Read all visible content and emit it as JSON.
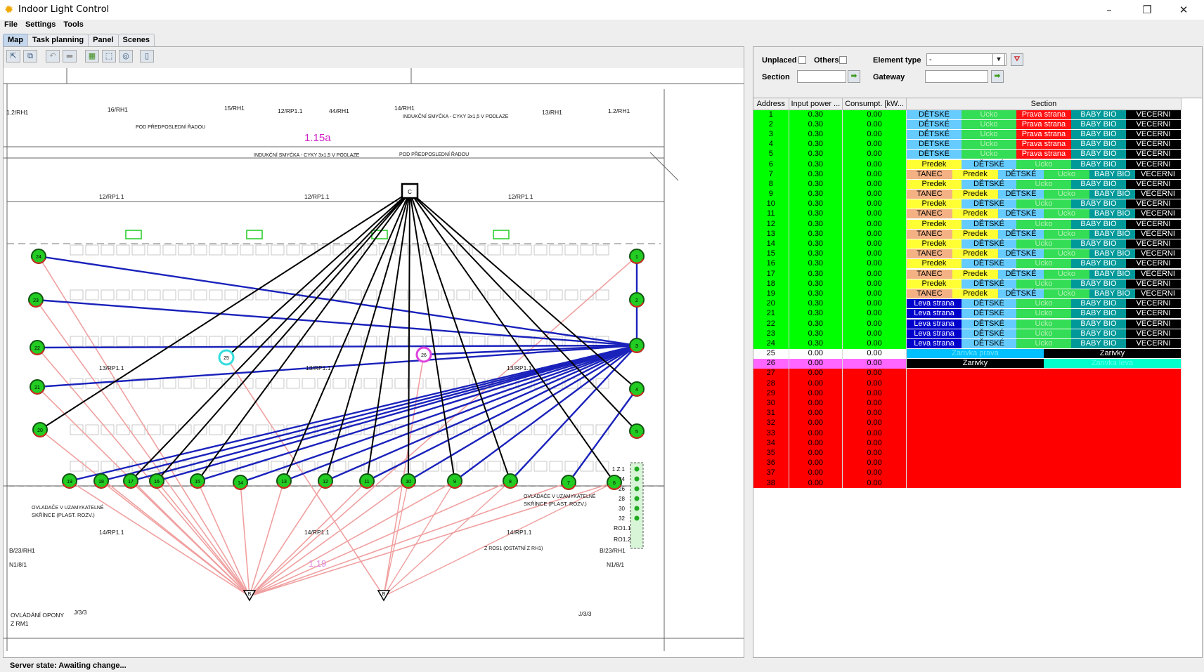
{
  "window": {
    "title": "Indoor Light Control",
    "minimize": "–",
    "maximize": "❐",
    "close": "✕"
  },
  "menu": [
    "File",
    "Settings",
    "Tools"
  ],
  "tabs": [
    "Map",
    "Task planning",
    "Panel",
    "Scenes"
  ],
  "toolbar_icons": [
    "pointer-tool",
    "multi-select-tool",
    "undo",
    "delete",
    "layer-tool",
    "fit-tool",
    "zoom-tool",
    "window-tool"
  ],
  "map": {
    "room_label": "1.15a",
    "room_label_2": "1.19",
    "controller_label": "C",
    "gateway_label": "B",
    "colors": {
      "element_ring_green": "#00cc00",
      "link_black": "#000000",
      "link_blue": "#1a22bb",
      "link_pink": "#f0a0a0",
      "room_label": "#d020c8"
    },
    "texts": [
      "1.2/RH1",
      "16/RH1",
      "15/RH1",
      "12/RP1.1",
      "44/RH1",
      "14/RH1",
      "13/RH1",
      "1.2/RH1",
      "POD PŘEDPOSLEDNÍ ŘADOU",
      "INDUKČNÍ SMYČKA - CYKY 3x1,5 V PODLAZE",
      "INDUKČNÍ SMYČKA - CYKY 3x1,5 V PODLAZE",
      "POD PŘEDPOSLEDNÍ ŘADOU",
      "12/RP1.1",
      "12/RP1.1",
      "12/RP1.1",
      "13/RP1.1",
      "13/RP1.1",
      "13/RP1.1",
      "OVLADAČE V UZAMYKATELNÉ SKŘÍNCE (PLAST. ROZV.)",
      "OVLADAČE V UZAMYKATELNÉ SKŘÍNCE (PLAST. ROZV.)",
      "14/RP1.1",
      "14/RP1.1",
      "14/RP1.1",
      "B/23/RH1",
      "N1/8/1",
      "B/23/RH1",
      "N1/8/1",
      "Z ROS1 (OSTATNÍ Z RH1)",
      "RO1.1",
      "RO1.2",
      "OVLÁDÁNÍ OPONY",
      "Z RM1",
      "J/3/3",
      "J/3/3"
    ],
    "panel_labels": [
      "1.Z.1",
      "24",
      "26",
      "28",
      "30",
      "32"
    ],
    "elements": [
      "1",
      "2",
      "3",
      "4",
      "5",
      "6",
      "7",
      "8",
      "9",
      "10",
      "11",
      "12",
      "13",
      "14",
      "15",
      "16",
      "17",
      "18",
      "19",
      "20",
      "21",
      "22",
      "23",
      "24",
      "25",
      "26"
    ]
  },
  "filter": {
    "unplaced_label": "Unplaced",
    "others_label": "Others",
    "element_type_label": "Element type",
    "element_type_value": "-",
    "section_label": "Section",
    "gateway_label": "Gateway",
    "section_value": "",
    "gateway_value": ""
  },
  "grid": {
    "headers": [
      "Address",
      "Input power ...",
      "Consumpt. [kW...",
      "Section"
    ],
    "colors": {
      "green": "#00ff00",
      "white": "#ffffff",
      "magenta": "#ff66ff",
      "red": "#ff0000"
    },
    "section_colors": {
      "DĚTSKÉ": [
        "#66ccff",
        "#000"
      ],
      "Ucko": [
        "#33dd55",
        "#b7f0b7"
      ],
      "Prava strana": [
        "#ff1111",
        "#fff"
      ],
      "BABY BIO": [
        "#009999",
        "#fff"
      ],
      "VECERNI": [
        "#000000",
        "#fff"
      ],
      "Predek": [
        "#ffff33",
        "#000"
      ],
      "TANEC": [
        "#f4b183",
        "#000"
      ],
      "Leva strana": [
        "#0000cc",
        "#fff"
      ],
      "Zarivka prava": [
        "#00c0ff",
        "#70e6ff"
      ],
      "Zarivky": [
        "#000000",
        "#fff"
      ],
      "Zarivka leva": [
        "#00ffcc",
        "#66ffee"
      ]
    },
    "rows": [
      {
        "addr": "1",
        "inp": "0.30",
        "cons": "0.00",
        "bg": "green",
        "sections": [
          "DĚTSKÉ",
          "Ucko",
          "Prava strana",
          "BABY BIO",
          "VECERNI"
        ]
      },
      {
        "addr": "2",
        "inp": "0.30",
        "cons": "0.00",
        "bg": "green",
        "sections": [
          "DĚTSKÉ",
          "Ucko",
          "Prava strana",
          "BABY BIO",
          "VECERNI"
        ]
      },
      {
        "addr": "3",
        "inp": "0.30",
        "cons": "0.00",
        "bg": "green",
        "sections": [
          "DĚTSKÉ",
          "Ucko",
          "Prava strana",
          "BABY BIO",
          "VECERNI"
        ]
      },
      {
        "addr": "4",
        "inp": "0.30",
        "cons": "0.00",
        "bg": "green",
        "sections": [
          "DĚTSKÉ",
          "Ucko",
          "Prava strana",
          "BABY BIO",
          "VECERNI"
        ]
      },
      {
        "addr": "5",
        "inp": "0.30",
        "cons": "0.00",
        "bg": "green",
        "sections": [
          "DĚTSKÉ",
          "Ucko",
          "Prava strana",
          "BABY BIO",
          "VECERNI"
        ]
      },
      {
        "addr": "6",
        "inp": "0.30",
        "cons": "0.00",
        "bg": "green",
        "sections": [
          "Predek",
          "DĚTSKÉ",
          "Ucko",
          "BABY BIO",
          "VECERNI"
        ]
      },
      {
        "addr": "7",
        "inp": "0.30",
        "cons": "0.00",
        "bg": "green",
        "sections": [
          "TANEC",
          "Predek",
          "DĚTSKÉ",
          "Ucko",
          "BABY BIO",
          "VECERNI"
        ]
      },
      {
        "addr": "8",
        "inp": "0.30",
        "cons": "0.00",
        "bg": "green",
        "sections": [
          "Predek",
          "DĚTSKÉ",
          "Ucko",
          "BABY BIO",
          "VECERNI"
        ]
      },
      {
        "addr": "9",
        "inp": "0.30",
        "cons": "0.00",
        "bg": "green",
        "sections": [
          "TANEC",
          "Predek",
          "DĚTSKÉ",
          "Ucko",
          "BABY BIO",
          "VECERNI"
        ]
      },
      {
        "addr": "10",
        "inp": "0.30",
        "cons": "0.00",
        "bg": "green",
        "sections": [
          "Predek",
          "DĚTSKÉ",
          "Ucko",
          "BABY BIO",
          "VECERNI"
        ]
      },
      {
        "addr": "11",
        "inp": "0.30",
        "cons": "0.00",
        "bg": "green",
        "sections": [
          "TANEC",
          "Predek",
          "DĚTSKÉ",
          "Ucko",
          "BABY BIO",
          "VECERNI"
        ]
      },
      {
        "addr": "12",
        "inp": "0.30",
        "cons": "0.00",
        "bg": "green",
        "sections": [
          "Predek",
          "DĚTSKÉ",
          "Ucko",
          "BABY BIO",
          "VECERNI"
        ]
      },
      {
        "addr": "13",
        "inp": "0.30",
        "cons": "0.00",
        "bg": "green",
        "sections": [
          "TANEC",
          "Predek",
          "DĚTSKÉ",
          "Ucko",
          "BABY BIO",
          "VECERNI"
        ]
      },
      {
        "addr": "14",
        "inp": "0.30",
        "cons": "0.00",
        "bg": "green",
        "sections": [
          "Predek",
          "DĚTSKÉ",
          "Ucko",
          "BABY BIO",
          "VECERNI"
        ]
      },
      {
        "addr": "15",
        "inp": "0.30",
        "cons": "0.00",
        "bg": "green",
        "sections": [
          "TANEC",
          "Predek",
          "DĚTSKÉ",
          "Ucko",
          "BABY BIO",
          "VECERNI"
        ]
      },
      {
        "addr": "16",
        "inp": "0.30",
        "cons": "0.00",
        "bg": "green",
        "sections": [
          "Predek",
          "DĚTSKÉ",
          "Ucko",
          "BABY BIO",
          "VECERNI"
        ]
      },
      {
        "addr": "17",
        "inp": "0.30",
        "cons": "0.00",
        "bg": "green",
        "sections": [
          "TANEC",
          "Predek",
          "DĚTSKÉ",
          "Ucko",
          "BABY BIO",
          "VECERNI"
        ]
      },
      {
        "addr": "18",
        "inp": "0.30",
        "cons": "0.00",
        "bg": "green",
        "sections": [
          "Predek",
          "DĚTSKÉ",
          "Ucko",
          "BABY BIO",
          "VECERNI"
        ]
      },
      {
        "addr": "19",
        "inp": "0.30",
        "cons": "0.00",
        "bg": "green",
        "sections": [
          "TANEC",
          "Predek",
          "DĚTSKÉ",
          "Ucko",
          "BABY BIO",
          "VECERNI"
        ]
      },
      {
        "addr": "20",
        "inp": "0.30",
        "cons": "0.00",
        "bg": "green",
        "sections": [
          "Leva strana",
          "DĚTSKÉ",
          "Ucko",
          "BABY BIO",
          "VECERNI"
        ]
      },
      {
        "addr": "21",
        "inp": "0.30",
        "cons": "0.00",
        "bg": "green",
        "sections": [
          "Leva strana",
          "DĚTSKÉ",
          "Ucko",
          "BABY BIO",
          "VECERNI"
        ]
      },
      {
        "addr": "22",
        "inp": "0.30",
        "cons": "0.00",
        "bg": "green",
        "sections": [
          "Leva strana",
          "DĚTSKÉ",
          "Ucko",
          "BABY BIO",
          "VECERNI"
        ]
      },
      {
        "addr": "23",
        "inp": "0.30",
        "cons": "0.00",
        "bg": "green",
        "sections": [
          "Leva strana",
          "DĚTSKÉ",
          "Ucko",
          "BABY BIO",
          "VECERNI"
        ]
      },
      {
        "addr": "24",
        "inp": "0.30",
        "cons": "0.00",
        "bg": "green",
        "sections": [
          "Leva strana",
          "DĚTSKÉ",
          "Ucko",
          "BABY BIO",
          "VECERNI"
        ]
      },
      {
        "addr": "25",
        "inp": "0.00",
        "cons": "0.00",
        "bg": "white",
        "sections": [
          "Zarivka prava",
          "Zarivky"
        ]
      },
      {
        "addr": "26",
        "inp": "0.00",
        "cons": "0.00",
        "bg": "magenta",
        "sections": [
          "Zarivky",
          "Zarivka leva"
        ]
      },
      {
        "addr": "27",
        "inp": "0.00",
        "cons": "0.00",
        "bg": "red",
        "sections": []
      },
      {
        "addr": "28",
        "inp": "0.00",
        "cons": "0.00",
        "bg": "red",
        "sections": []
      },
      {
        "addr": "29",
        "inp": "0.00",
        "cons": "0.00",
        "bg": "red",
        "sections": []
      },
      {
        "addr": "30",
        "inp": "0.00",
        "cons": "0.00",
        "bg": "red",
        "sections": []
      },
      {
        "addr": "31",
        "inp": "0.00",
        "cons": "0.00",
        "bg": "red",
        "sections": []
      },
      {
        "addr": "32",
        "inp": "0.00",
        "cons": "0.00",
        "bg": "red",
        "sections": []
      },
      {
        "addr": "33",
        "inp": "0.00",
        "cons": "0.00",
        "bg": "red",
        "sections": []
      },
      {
        "addr": "34",
        "inp": "0.00",
        "cons": "0.00",
        "bg": "red",
        "sections": []
      },
      {
        "addr": "35",
        "inp": "0.00",
        "cons": "0.00",
        "bg": "red",
        "sections": []
      },
      {
        "addr": "36",
        "inp": "0.00",
        "cons": "0.00",
        "bg": "red",
        "sections": []
      },
      {
        "addr": "37",
        "inp": "0.00",
        "cons": "0.00",
        "bg": "red",
        "sections": []
      },
      {
        "addr": "38",
        "inp": "0.00",
        "cons": "0.00",
        "bg": "red",
        "sections": []
      }
    ]
  },
  "status": {
    "text": "Server state: Awaiting change..."
  }
}
